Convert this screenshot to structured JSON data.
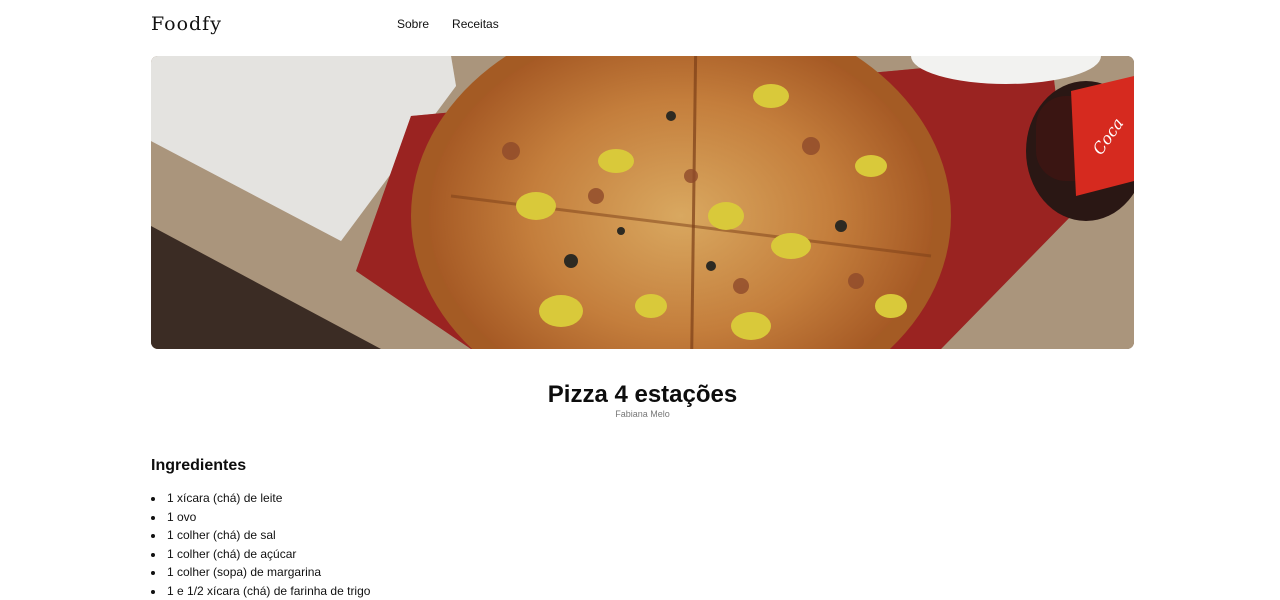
{
  "header": {
    "logo": "Foodfy",
    "nav": [
      {
        "label": "Sobre"
      },
      {
        "label": "Receitas"
      }
    ]
  },
  "recipe": {
    "title": "Pizza 4 estações",
    "author": "Fabiana Melo",
    "ingredients_heading": "Ingredientes",
    "ingredients": [
      "1 xícara (chá) de leite",
      "1 ovo",
      "1 colher (chá) de sal",
      "1 colher (chá) de açúcar",
      "1 colher (sopa) de margarina",
      "1 e 1/2 xícara (chá) de farinha de trigo"
    ]
  },
  "colors": {
    "text": "#111111",
    "muted": "#777777",
    "background": "#ffffff"
  }
}
